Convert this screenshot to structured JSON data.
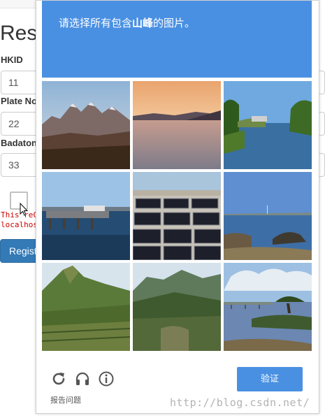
{
  "background_form": {
    "heading": "Res",
    "fields": [
      {
        "label": "HKID",
        "value": "11"
      },
      {
        "label": "Plate No",
        "value": "22"
      },
      {
        "label": "Badaton",
        "value": "33"
      }
    ],
    "error_line1": "This reC",
    "error_line2": "localhos",
    "register_button": "Regist"
  },
  "captcha": {
    "prompt_before": "请选择所有包含",
    "prompt_keyword": "山峰",
    "prompt_after": "的图片。",
    "tiles": [
      {
        "subject": "mountains"
      },
      {
        "subject": "sunset-lake"
      },
      {
        "subject": "river-bridge"
      },
      {
        "subject": "harbor-pier"
      },
      {
        "subject": "solar-panels"
      },
      {
        "subject": "sea-rocks"
      },
      {
        "subject": "forested-hill"
      },
      {
        "subject": "valley-hills"
      },
      {
        "subject": "lake-tree"
      }
    ],
    "footer": {
      "reload_icon": "reload-icon",
      "audio_icon": "headphones-icon",
      "info_icon": "info-icon",
      "report_label": "报告问题",
      "verify_label": "验证"
    },
    "accent_color": "#4a90e2"
  },
  "watermark": "http://blog.csdn.net/"
}
